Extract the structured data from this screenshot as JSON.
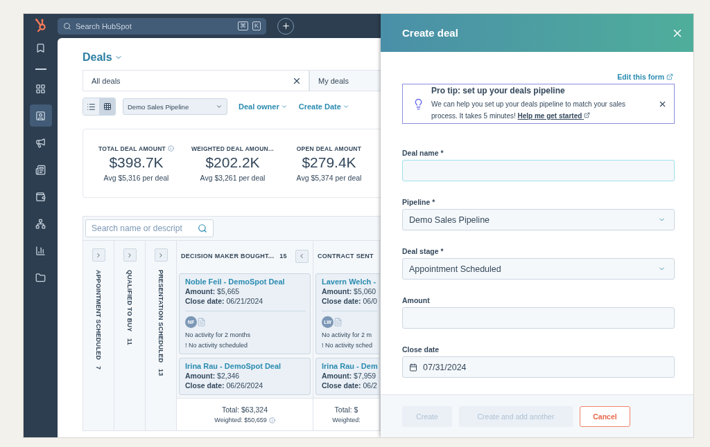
{
  "nav": {
    "items": [
      {
        "selected": false
      },
      {
        "selected": false
      },
      {
        "selected": true
      },
      {
        "selected": false
      },
      {
        "selected": false
      },
      {
        "selected": false
      },
      {
        "selected": false
      },
      {
        "selected": false
      },
      {
        "selected": false
      }
    ]
  },
  "topbar": {
    "search": {
      "placeholder": "Search HubSpot",
      "keys": [
        "⌘",
        "K"
      ]
    }
  },
  "page": {
    "title": "Deals",
    "tabs": [
      {
        "label": "All deals",
        "selected": true
      },
      {
        "label": "My deals",
        "selected": false
      }
    ],
    "view_toggle": [
      {
        "kind": "list",
        "selected": false
      },
      {
        "kind": "board",
        "selected": true
      }
    ],
    "pipeline_select": "Demo Sales Pipeline",
    "filters": [
      "Deal owner",
      "Create Date"
    ],
    "stats": [
      {
        "label": "TOTAL DEAL AMOUNT",
        "info": true,
        "value": "$398.7K",
        "avg": "Avg $5,316 per deal"
      },
      {
        "label": "WEIGHTED DEAL AMOUN...",
        "info": false,
        "value": "$202.2K",
        "avg": "Avg $3,261 per deal"
      },
      {
        "label": "OPEN DEAL AMOUNT",
        "info": false,
        "value": "$279.4K",
        "avg": "Avg $5,374 per deal"
      }
    ],
    "board": {
      "search": {
        "placeholder": "Search name or descript"
      },
      "collapsed_columns": [
        {
          "name": "APPOINTMENT SCHEDULED",
          "count": "7"
        },
        {
          "name": "QUALIFIED TO BUY",
          "count": "11"
        },
        {
          "name": "PRESENTATION SCHEDULED",
          "count": "13"
        }
      ],
      "columns": [
        {
          "name": "DECISION MAKER BOUGHT...",
          "count": "15",
          "total": "Total: $63,324",
          "weighted": "Weighted: $50,659",
          "info": true,
          "cards": [
            {
              "title": "Noble Feil - DemoSpot Deal",
              "amount": "**Amount:** $5,665",
              "close_date": "**Close date:** 06/21/2024",
              "initials": "NF",
              "activity": "No activity for 2 months",
              "scheduled": "! No activity scheduled"
            },
            {
              "title": "Irina Rau - DemoSpot Deal",
              "amount": "**Amount:** $2,346",
              "close_date": "**Close date:** 06/26/2024"
            }
          ]
        },
        {
          "name": "CONTRACT SENT",
          "total": "Total: $",
          "weighted": "Weighted:",
          "info": false,
          "cards": [
            {
              "title": "Lavern Welch -",
              "amount": "**Amount:** $5,060",
              "close_date": "**Close date:** 06/0",
              "initials": "LW",
              "activity": "No activity for 2 m",
              "scheduled": "! No activity sched"
            },
            {
              "title": "Irina Rau - Dem",
              "amount": "**Amount:** $7,959",
              "close_date": "**Close date:** 06/2"
            }
          ]
        }
      ]
    }
  },
  "modal": {
    "title": "Create deal",
    "edit_link": "Edit this form",
    "tip": {
      "title": "Pro tip: set up your deals pipeline",
      "text": "We can help you set up your deals pipeline to match your sales process. It takes 5 minutes!",
      "link": "Help me get started"
    },
    "fields": [
      {
        "kind": "text",
        "label": "Deal name *",
        "focused": true
      },
      {
        "kind": "select",
        "label": "Pipeline *",
        "value": "Demo Sales Pipeline"
      },
      {
        "kind": "select",
        "label": "Deal stage *",
        "value": "Appointment Scheduled"
      },
      {
        "kind": "text",
        "label": "Amount",
        "focused": false
      },
      {
        "kind": "date",
        "label": "Close date",
        "value": "07/31/2024"
      }
    ],
    "buttons": [
      {
        "label": "Create",
        "kind": "primary",
        "disabled": true
      },
      {
        "label": "Create and add another",
        "kind": "secondary",
        "disabled": true
      },
      {
        "label": "Cancel",
        "kind": "cancel",
        "disabled": false
      }
    ]
  }
}
